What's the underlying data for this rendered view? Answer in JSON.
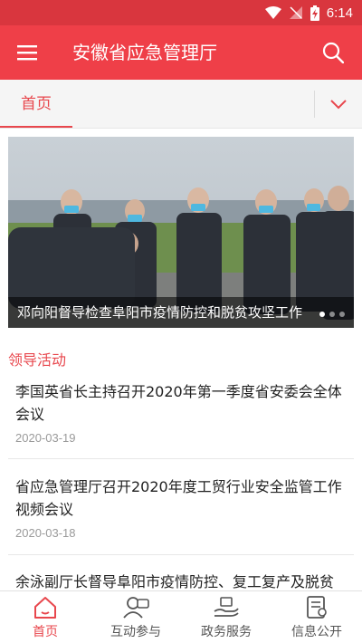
{
  "status_bar": {
    "time": "6:14"
  },
  "app_bar": {
    "title": "安徽省应急管理厅"
  },
  "tabs": {
    "active_label": "首页"
  },
  "banner": {
    "caption": "邓向阳督导检查阜阳市疫情防控和脱贫攻坚工作"
  },
  "section": {
    "title": "领导活动"
  },
  "news": [
    {
      "title": "李国英省长主持召开2020年第一季度省安委会全体会议",
      "date": "2020-03-19"
    },
    {
      "title": "省应急管理厅召开2020年度工贸行业安全监管工作视频会议",
      "date": "2020-03-18"
    },
    {
      "title": "余泳副厅长督导阜阳市疫情防控、复工复产及脱贫",
      "date": ""
    }
  ],
  "bottom_nav": [
    {
      "label": "首页",
      "icon": "home-icon",
      "active": true
    },
    {
      "label": "互动参与",
      "icon": "interaction-icon",
      "active": false
    },
    {
      "label": "政务服务",
      "icon": "service-icon",
      "active": false
    },
    {
      "label": "信息公开",
      "icon": "info-disclosure-icon",
      "active": false
    }
  ],
  "colors": {
    "primary": "#ef3f48",
    "status_bar": "#d9363e",
    "accent_text": "#e8474d"
  }
}
